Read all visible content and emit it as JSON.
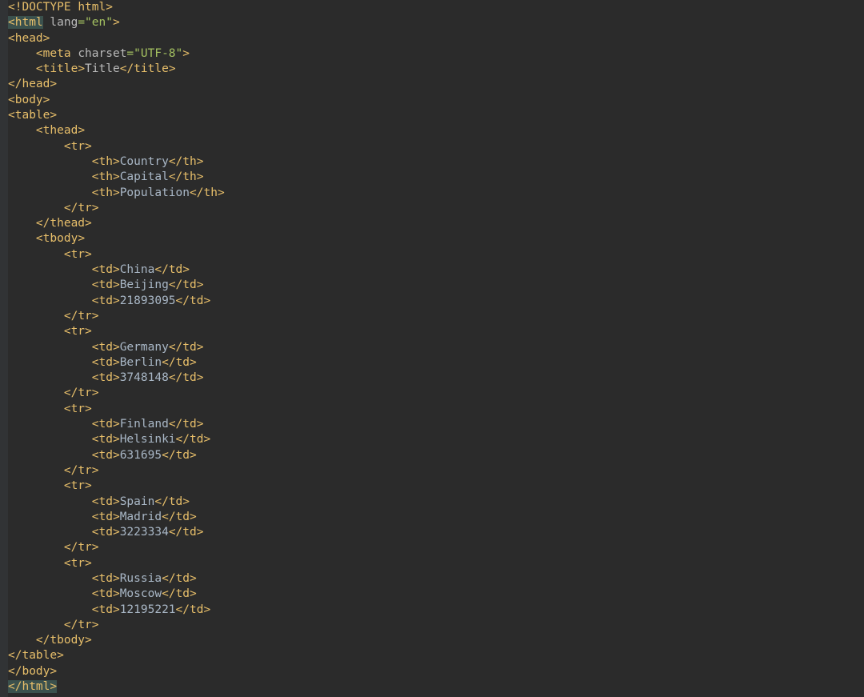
{
  "chars": {
    "lt": "<",
    "gt": ">",
    "eq": "=",
    "space": " ",
    "slash": "/",
    "bang": "!",
    "guide": "    "
  },
  "code": {
    "doctype_tag": "DOCTYPE",
    "doctype_html": "html",
    "html_tag": "html",
    "lang_attr": "lang",
    "lang_val": "\"en\"",
    "head_tag": "head",
    "meta_tag": "meta",
    "charset_attr": "charset",
    "charset_val": "\"UTF-8\"",
    "title_tag": "title",
    "title_text": "Title",
    "body_tag": "body",
    "table_tag": "table",
    "thead_tag": "thead",
    "tbody_tag": "tbody",
    "tr_tag": "tr",
    "th_tag": "th",
    "td_tag": "td",
    "headers": {
      "h1": "Country",
      "h2": "Capital",
      "h3": "Population"
    },
    "rows": [
      {
        "c": "China",
        "cap": "Beijing",
        "pop": "21893095"
      },
      {
        "c": "Germany",
        "cap": "Berlin",
        "pop": "3748148"
      },
      {
        "c": "Finland",
        "cap": "Helsinki",
        "pop": "631695"
      },
      {
        "c": "Spain",
        "cap": "Madrid",
        "pop": "3223334"
      },
      {
        "c": "Russia",
        "cap": "Moscow",
        "pop": "12195221"
      }
    ]
  }
}
